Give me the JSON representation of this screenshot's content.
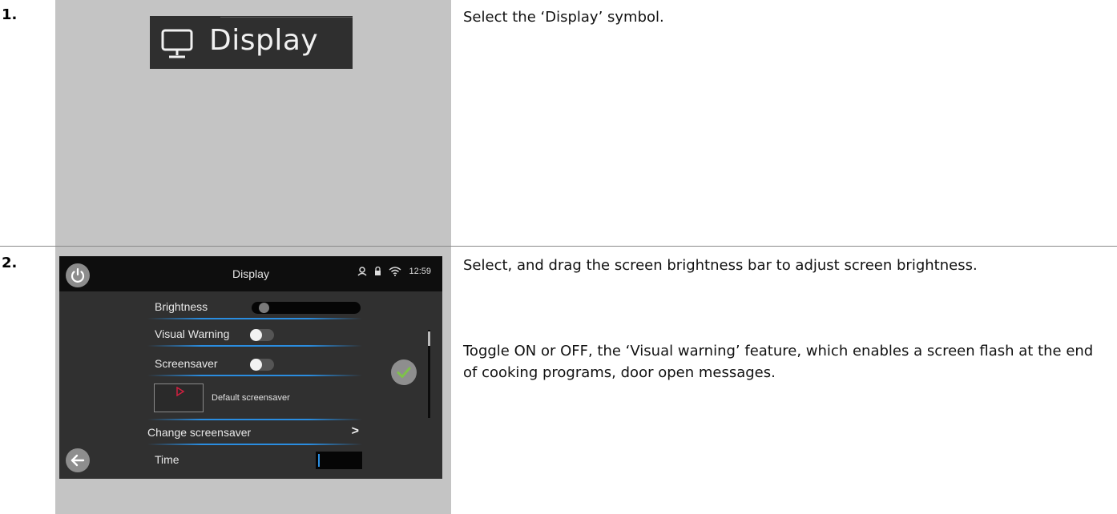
{
  "steps": [
    {
      "number": "1.",
      "display_button": {
        "label": "Display",
        "icon": "monitor-icon"
      },
      "description": "Select the ‘Display’ symbol."
    },
    {
      "number": "2.",
      "screen": {
        "title": "Display",
        "time": "12:59",
        "status_icons": [
          "person-icon",
          "lock-icon",
          "wifi-icon"
        ],
        "brightness_label": "Brightness",
        "brightness_level": 0.05,
        "visual_warning_label": "Visual Warning",
        "visual_warning_on": false,
        "screensaver_label": "Screensaver",
        "screensaver_on": false,
        "default_screensaver_label": "Default screensaver",
        "change_screensaver_label": "Change screensaver",
        "chevron": ">",
        "time_label": "Time"
      },
      "description_1": "Select, and drag the screen brightness bar to adjust screen brightness.",
      "description_2": "Toggle ON or OFF, the ‘Visual warning’ feature, which enables a screen flash at the end of cooking programs, door open messages."
    }
  ],
  "colors": {
    "accent_blue": "#2a8de0",
    "check_green": "#7ec24a",
    "panel_gray": "#c4c4c4"
  }
}
